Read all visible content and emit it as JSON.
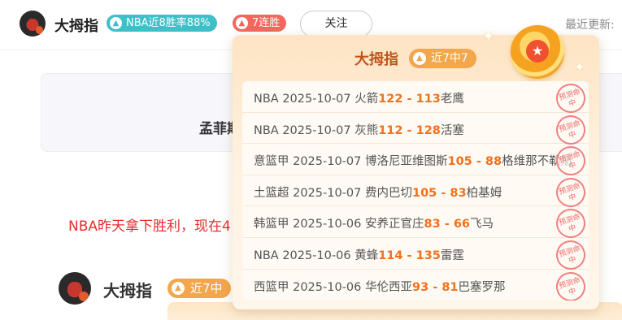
{
  "header": {
    "author_name": "大拇指",
    "badge_winrate": "NBA近8胜率88%",
    "badge_streak": "7连胜",
    "follow_label": "关注",
    "last_update_label": "最近更新:"
  },
  "background": {
    "card_title_fragment": "孟菲斯",
    "red_line": "NBA昨天拿下胜利，现在4",
    "author_name": "大拇指",
    "author_badge": "近7中"
  },
  "popover": {
    "title": "大拇指",
    "badge": "近7中7",
    "stamp_text": "预测命中",
    "matches": [
      {
        "league": "NBA",
        "date": "2025-10-07",
        "home": "火箭",
        "home_score": "122",
        "separator": " - ",
        "away_score": "113",
        "away": "老鹰"
      },
      {
        "league": "NBA",
        "date": "2025-10-07",
        "home": "灰熊",
        "home_score": "112",
        "separator": " - ",
        "away_score": "128",
        "away": "活塞"
      },
      {
        "league": "意篮甲",
        "date": "2025-10-07",
        "home": "博洛尼亚维图斯",
        "home_score": "105",
        "separator": " - ",
        "away_score": "88",
        "away": "格维那不勒斯"
      },
      {
        "league": "土篮超",
        "date": "2025-10-07",
        "home": "费内巴切",
        "home_score": "105",
        "separator": " - ",
        "away_score": "83",
        "away": "柏基姆"
      },
      {
        "league": "韩篮甲",
        "date": "2025-10-06",
        "home": "安养正官庄",
        "home_score": "83",
        "separator": " - ",
        "away_score": "66",
        "away": "飞马"
      },
      {
        "league": "NBA",
        "date": "2025-10-06",
        "home": "黄蜂",
        "home_score": "114",
        "separator": " - ",
        "away_score": "135",
        "away": "雷霆"
      },
      {
        "league": "西篮甲",
        "date": "2025-10-06",
        "home": "华伦西亚",
        "home_score": "93",
        "separator": " - ",
        "away_score": "81",
        "away": "巴塞罗那"
      }
    ]
  },
  "icons": {
    "badge_icon": "arrow-up-icon",
    "medal_icon": "star-medal-icon",
    "stamp_icon": "hit-stamp-icon"
  },
  "colors": {
    "score": "#f2711c",
    "streak_badge": "#f2685f",
    "winrate_badge": "#3fc0c9",
    "popover_badge": "#f3a64a",
    "red_text": "#e62e2e"
  }
}
